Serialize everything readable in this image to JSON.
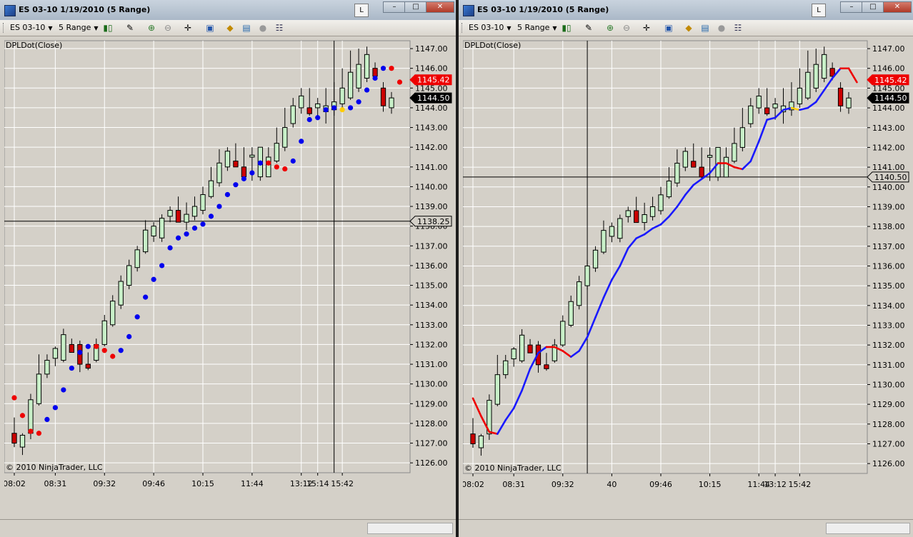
{
  "windows": [
    {
      "title": "ES 03-10  1/19/2010 (5 Range)",
      "link_button": "L",
      "toolbar": {
        "instrument": "ES 03-10",
        "period": "5 Range"
      },
      "indicator_label": "DPLDot(Close)",
      "copyright": "© 2010 NinjaTrader, LLC",
      "price_ticks": [
        "1147.00",
        "1146.00",
        "1145.00",
        "1144.00",
        "1143.00",
        "1142.00",
        "1141.00",
        "1140.00",
        "1139.00",
        "1138.00",
        "1137.00",
        "1136.00",
        "1135.00",
        "1134.00",
        "1133.00",
        "1132.00",
        "1131.00",
        "1130.00",
        "1129.00",
        "1128.00",
        "1127.00",
        "1126.00"
      ],
      "time_labels": [
        "08:02",
        "08:31",
        "09:32",
        "09:46",
        "10:15",
        "11:44",
        "13:12",
        "15:14",
        "15:42"
      ],
      "markers": {
        "last_price": "1145.42",
        "current_price": "1144.50",
        "crosshair_price": "1138.25"
      },
      "crosshair": {
        "price": 1138.25,
        "bar": 39
      },
      "indicator_style": "dots"
    },
    {
      "title": "ES 03-10  1/19/2010 (5 Range)",
      "link_button": "L",
      "toolbar": {
        "instrument": "ES 03-10",
        "period": "5 Range"
      },
      "indicator_label": "DPLDot(Close)",
      "copyright": "© 2010 NinjaTrader, LLC",
      "price_ticks": [
        "1147.00",
        "1146.00",
        "1145.00",
        "1144.00",
        "1143.00",
        "1142.00",
        "1141.00",
        "1140.00",
        "1139.00",
        "1138.00",
        "1137.00",
        "1136.00",
        "1135.00",
        "1134.00",
        "1133.00",
        "1132.00",
        "1131.00",
        "1130.00",
        "1129.00",
        "1128.00",
        "1127.00",
        "1126.00"
      ],
      "time_labels": [
        "08:02",
        "08:31",
        "09:32",
        "40",
        "09:46",
        "10:15",
        "11:44",
        "13:12",
        "15:42"
      ],
      "markers": {
        "last_price": "1145.42",
        "current_price": "1144.50",
        "crosshair_price": "1140.50"
      },
      "crosshair": {
        "price": 1140.5,
        "bar": 14
      },
      "indicator_style": "line"
    }
  ],
  "colors": {
    "up": "#c8f0c8",
    "down": "#cc0000",
    "dot_up": "#0000ee",
    "dot_down": "#ee0000",
    "dot_neutral": "#ffcc00",
    "line_up": "#1a1aff",
    "line_down": "#ee0000"
  },
  "chart_data": {
    "type": "candlestick",
    "instrument": "ES 03-10",
    "ylim": [
      1125.5,
      1147.4
    ],
    "x": [
      "08:02",
      "",
      "",
      "",
      "",
      "08:31",
      "",
      "",
      "",
      "",
      "",
      "09:32",
      "",
      "",
      "",
      "",
      "",
      "09:46",
      "",
      "",
      "",
      "",
      "",
      "10:15",
      "",
      "",
      "",
      "",
      "",
      "11:44",
      "",
      "",
      "",
      "",
      "",
      "13:12",
      "",
      "15:14",
      "",
      "",
      "15:42",
      "",
      "",
      "",
      "",
      "",
      ""
    ],
    "open": [
      1127.5,
      1126.8,
      1127.5,
      1129.0,
      1130.5,
      1131.3,
      1131.2,
      1132.0,
      1132.0,
      1131.0,
      1131.2,
      1132.0,
      1133.0,
      1134.0,
      1135.0,
      1135.9,
      1136.7,
      1137.5,
      1137.4,
      1138.5,
      1138.8,
      1138.2,
      1138.5,
      1138.8,
      1139.5,
      1140.2,
      1141.0,
      1141.3,
      1141.0,
      1141.5,
      1140.5,
      1140.5,
      1141.3,
      1142.0,
      1143.2,
      1144.0,
      1144.0,
      1144.0,
      1143.8,
      1143.9,
      1144.2,
      1144.5,
      1145.0,
      1145.5,
      1146.0,
      1145.0,
      1144.0
    ],
    "high": [
      1128.3,
      1127.5,
      1129.5,
      1131.5,
      1131.5,
      1131.9,
      1132.8,
      1132.3,
      1132.2,
      1131.6,
      1132.3,
      1133.5,
      1134.5,
      1135.5,
      1136.3,
      1137.0,
      1138.3,
      1138.2,
      1138.6,
      1139.0,
      1139.5,
      1139.2,
      1139.5,
      1140.0,
      1141.0,
      1141.9,
      1142.0,
      1142.2,
      1142.0,
      1142.0,
      1142.0,
      1142.0,
      1143.0,
      1144.0,
      1144.5,
      1145.0,
      1145.0,
      1144.5,
      1145.0,
      1145.3,
      1146.0,
      1146.9,
      1147.0,
      1147.1,
      1146.3,
      1145.3,
      1144.8
    ],
    "low": [
      1126.8,
      1126.4,
      1127.2,
      1128.9,
      1130.3,
      1130.9,
      1131.1,
      1131.7,
      1130.6,
      1130.7,
      1131.1,
      1131.9,
      1132.9,
      1133.8,
      1134.8,
      1135.7,
      1136.6,
      1137.2,
      1137.2,
      1138.2,
      1138.6,
      1137.8,
      1138.3,
      1138.6,
      1139.4,
      1140.0,
      1140.8,
      1141.2,
      1140.4,
      1140.3,
      1140.3,
      1140.5,
      1141.2,
      1141.8,
      1143.0,
      1143.7,
      1143.6,
      1143.4,
      1143.2,
      1143.6,
      1144.0,
      1144.4,
      1144.8,
      1145.3,
      1145.4,
      1143.8,
      1143.7
    ],
    "close": [
      1127.0,
      1127.4,
      1129.2,
      1130.5,
      1131.2,
      1131.8,
      1132.5,
      1131.6,
      1131.0,
      1130.8,
      1132.0,
      1133.2,
      1134.2,
      1135.2,
      1136.0,
      1136.8,
      1137.8,
      1138.0,
      1138.4,
      1138.8,
      1138.2,
      1138.6,
      1139.0,
      1139.6,
      1140.3,
      1141.2,
      1141.8,
      1141.0,
      1140.5,
      1141.6,
      1142.0,
      1141.5,
      1142.2,
      1143.0,
      1144.1,
      1144.6,
      1143.7,
      1144.2,
      1144.1,
      1144.3,
      1145.0,
      1145.8,
      1146.2,
      1146.7,
      1145.6,
      1144.1,
      1144.5
    ],
    "dpl_dots": [
      {
        "bar": 0,
        "price": 1129.3,
        "dir": "down"
      },
      {
        "bar": 1,
        "price": 1128.4,
        "dir": "down"
      },
      {
        "bar": 2,
        "price": 1127.6,
        "dir": "down"
      },
      {
        "bar": 3,
        "price": 1127.5,
        "dir": "down"
      },
      {
        "bar": 4,
        "price": 1128.2,
        "dir": "up"
      },
      {
        "bar": 5,
        "price": 1128.8,
        "dir": "up"
      },
      {
        "bar": 6,
        "price": 1129.7,
        "dir": "up"
      },
      {
        "bar": 7,
        "price": 1130.8,
        "dir": "up"
      },
      {
        "bar": 8,
        "price": 1131.6,
        "dir": "up"
      },
      {
        "bar": 9,
        "price": 1131.9,
        "dir": "up"
      },
      {
        "bar": 10,
        "price": 1131.9,
        "dir": "down"
      },
      {
        "bar": 11,
        "price": 1131.7,
        "dir": "down"
      },
      {
        "bar": 12,
        "price": 1131.4,
        "dir": "down"
      },
      {
        "bar": 13,
        "price": 1131.7,
        "dir": "up"
      },
      {
        "bar": 14,
        "price": 1132.4,
        "dir": "up"
      },
      {
        "bar": 15,
        "price": 1133.4,
        "dir": "up"
      },
      {
        "bar": 16,
        "price": 1134.4,
        "dir": "up"
      },
      {
        "bar": 17,
        "price": 1135.3,
        "dir": "up"
      },
      {
        "bar": 18,
        "price": 1136.0,
        "dir": "up"
      },
      {
        "bar": 19,
        "price": 1136.9,
        "dir": "up"
      },
      {
        "bar": 20,
        "price": 1137.4,
        "dir": "up"
      },
      {
        "bar": 21,
        "price": 1137.6,
        "dir": "up"
      },
      {
        "bar": 22,
        "price": 1137.9,
        "dir": "up"
      },
      {
        "bar": 23,
        "price": 1138.1,
        "dir": "up"
      },
      {
        "bar": 24,
        "price": 1138.5,
        "dir": "up"
      },
      {
        "bar": 25,
        "price": 1139.0,
        "dir": "up"
      },
      {
        "bar": 26,
        "price": 1139.6,
        "dir": "up"
      },
      {
        "bar": 27,
        "price": 1140.1,
        "dir": "up"
      },
      {
        "bar": 28,
        "price": 1140.4,
        "dir": "up"
      },
      {
        "bar": 29,
        "price": 1140.7,
        "dir": "up"
      },
      {
        "bar": 30,
        "price": 1141.2,
        "dir": "up"
      },
      {
        "bar": 31,
        "price": 1141.2,
        "dir": "down"
      },
      {
        "bar": 32,
        "price": 1141.0,
        "dir": "down"
      },
      {
        "bar": 33,
        "price": 1140.9,
        "dir": "down"
      },
      {
        "bar": 34,
        "price": 1141.3,
        "dir": "up"
      },
      {
        "bar": 35,
        "price": 1142.3,
        "dir": "up"
      },
      {
        "bar": 36,
        "price": 1143.4,
        "dir": "up"
      },
      {
        "bar": 37,
        "price": 1143.5,
        "dir": "up"
      },
      {
        "bar": 38,
        "price": 1143.9,
        "dir": "up"
      },
      {
        "bar": 39,
        "price": 1144.0,
        "dir": "up"
      },
      {
        "bar": 40,
        "price": 1143.9,
        "dir": "neutral"
      },
      {
        "bar": 41,
        "price": 1144.0,
        "dir": "up"
      },
      {
        "bar": 42,
        "price": 1144.3,
        "dir": "up"
      },
      {
        "bar": 43,
        "price": 1144.9,
        "dir": "up"
      },
      {
        "bar": 44,
        "price": 1145.5,
        "dir": "up"
      },
      {
        "bar": 45,
        "price": 1146.0,
        "dir": "up"
      },
      {
        "bar": 46,
        "price": 1146.0,
        "dir": "down"
      },
      {
        "bar": 47,
        "price": 1145.3,
        "dir": "down"
      }
    ]
  }
}
